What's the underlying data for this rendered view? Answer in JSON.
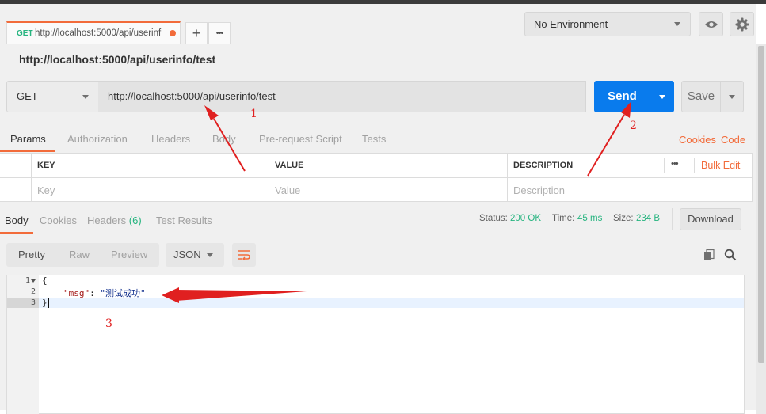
{
  "tab": {
    "method": "GET",
    "url": "http://localhost:5000/api/userinf",
    "add_label": "+",
    "more_label": "•••"
  },
  "environment": {
    "selected": "No Environment"
  },
  "request": {
    "title": "http://localhost:5000/api/userinfo/test",
    "method": "GET",
    "url": "http://localhost:5000/api/userinfo/test",
    "send_label": "Send",
    "save_label": "Save"
  },
  "request_tabs": [
    "Params",
    "Authorization",
    "Headers",
    "Body",
    "Pre-request Script",
    "Tests"
  ],
  "request_links": {
    "cookies": "Cookies",
    "code": "Code"
  },
  "params": {
    "headers": [
      "KEY",
      "VALUE",
      "DESCRIPTION"
    ],
    "more": "•••",
    "bulk_edit": "Bulk Edit",
    "placeholders": [
      "Key",
      "Value",
      "Description"
    ]
  },
  "response": {
    "tabs": {
      "body": "Body",
      "cookies": "Cookies",
      "headers": "Headers",
      "headers_count": "(6)",
      "tests": "Test Results"
    },
    "status_label": "Status:",
    "status": "200 OK",
    "time_label": "Time:",
    "time": "45 ms",
    "size_label": "Size:",
    "size": "234 B",
    "download_label": "Download"
  },
  "format": {
    "modes": [
      "Pretty",
      "Raw",
      "Preview"
    ],
    "selected_type": "JSON"
  },
  "code": {
    "line_numbers": [
      "1",
      "2",
      "3"
    ],
    "open_brace": "{",
    "key": "\"msg\"",
    "colon": ": ",
    "value": "\"测试成功\"",
    "close_brace": "}"
  },
  "annotations": [
    "1",
    "2",
    "3"
  ],
  "colors": {
    "accent": "#f26b3a",
    "send": "#097bed",
    "success": "#26b47f",
    "annotation": "#e02020"
  }
}
